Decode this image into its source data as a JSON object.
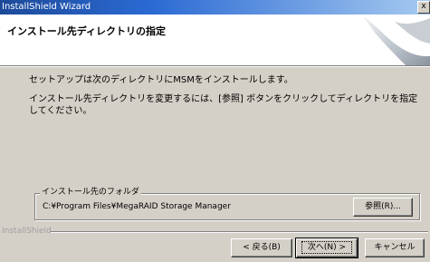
{
  "window": {
    "title": "InstallShield Wizard",
    "close_glyph": "x"
  },
  "header": {
    "title": "インストール先ディレクトリの指定"
  },
  "body": {
    "line1": "セットアップは次のディレクトリにMSMをインストールします。",
    "line2": "インストール先ディレクトリを変更するには、[参照] ボタンをクリックしてディレクトリを指定してください。"
  },
  "destination": {
    "group_label": "インストール先のフォルダ",
    "path": "C:¥Program Files¥MegaRAID Storage Manager",
    "browse_label": "参照(R)..."
  },
  "footer": {
    "brand": "InstallShield",
    "back_label": "< 戻る(B)",
    "next_label": "次へ(N) >",
    "cancel_label": "キャンセル"
  },
  "colors": {
    "title_bar_start": "#1c4a99",
    "title_bar_end": "#a6caf0",
    "dialog_face": "#d4d0c8",
    "header_bg": "#ffffff"
  },
  "icons": {
    "header_art": "installshield-wave-icon",
    "close": "close-icon"
  }
}
